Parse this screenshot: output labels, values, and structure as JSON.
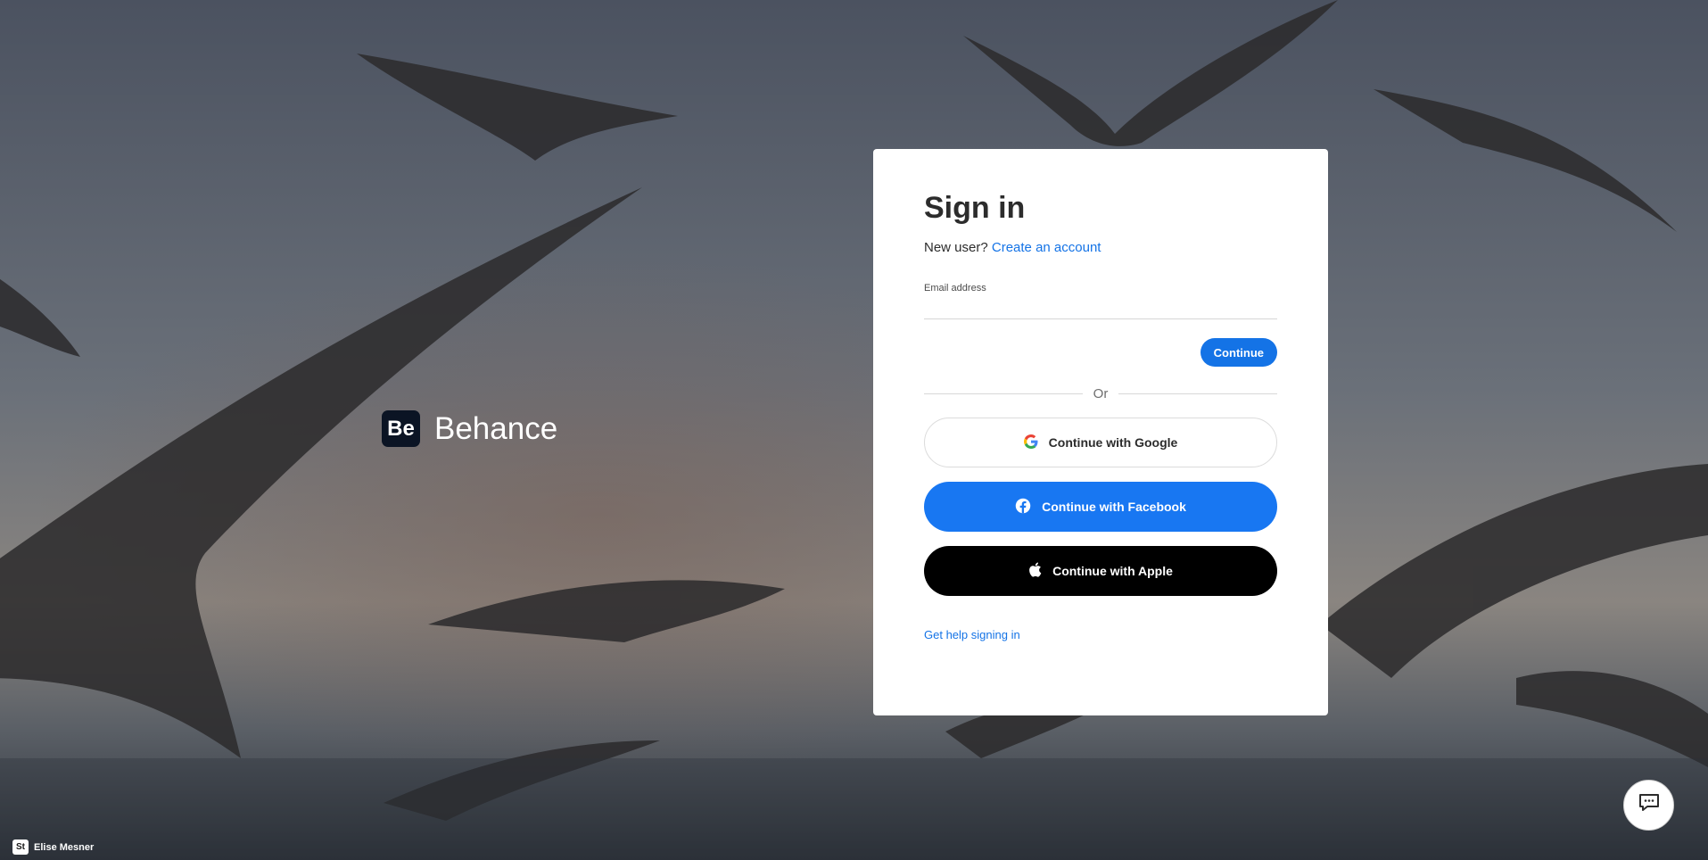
{
  "brand": {
    "logo_text": "Be",
    "name": "Behance"
  },
  "signin": {
    "title": "Sign in",
    "new_user_text": "New user?",
    "create_account_link": "Create an account",
    "email_label": "Email address",
    "email_value": "",
    "continue_button": "Continue",
    "or_text": "Or",
    "google_button": "Continue with Google",
    "facebook_button": "Continue with Facebook",
    "apple_button": "Continue with Apple",
    "help_link": "Get help signing in"
  },
  "photo_credit": {
    "logo_text": "St",
    "name": "Elise Mesner"
  },
  "colors": {
    "accent": "#1473e6",
    "facebook": "#1877f2",
    "apple": "#000000"
  },
  "icons": {
    "google": "google-icon",
    "facebook": "facebook-icon",
    "apple": "apple-icon",
    "chat": "chat-icon"
  }
}
